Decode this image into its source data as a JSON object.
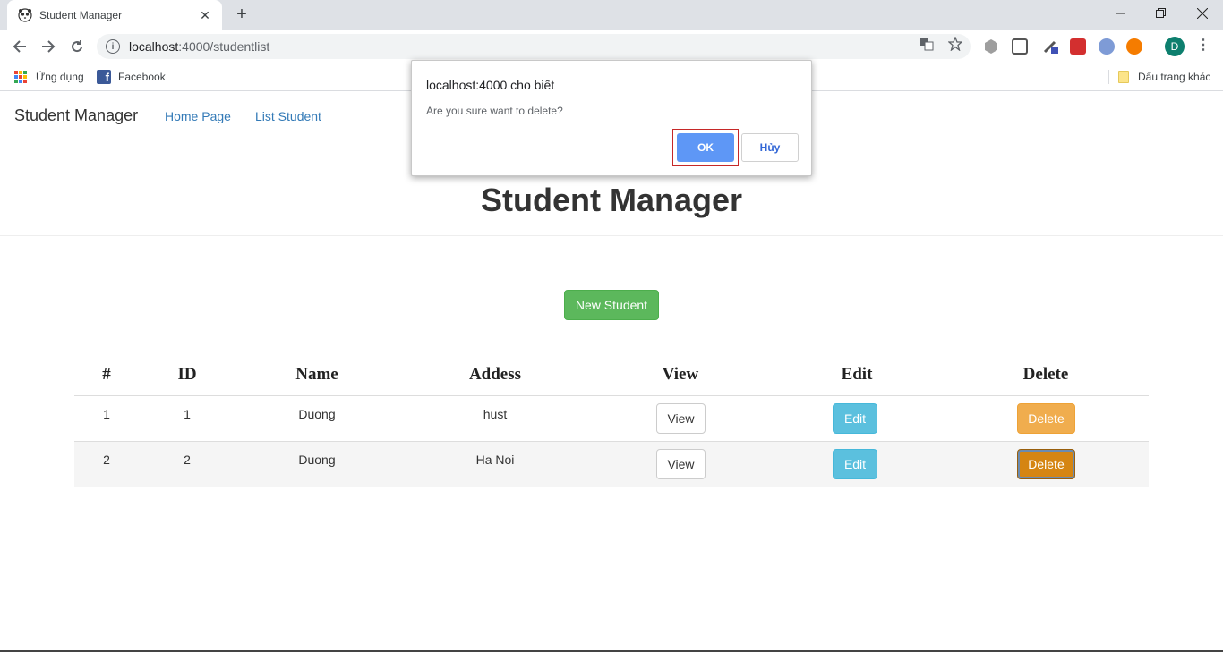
{
  "browser": {
    "tab_title": "Student Manager",
    "tab_close": "✕",
    "new_tab": "+",
    "url_host": "localhost",
    "url_rest": ":4000/studentlist",
    "profile_initial": "D",
    "bookmarks": {
      "apps_label": "Ứng dụng",
      "facebook_label": "Facebook",
      "other_label": "Dấu trang khác"
    }
  },
  "page": {
    "brand": "Student Manager",
    "nav": [
      "Home Page",
      "List Student"
    ],
    "title": "Student Manager",
    "new_button": "New Student",
    "table": {
      "headers": [
        "#",
        "ID",
        "Name",
        "Addess",
        "View",
        "Edit",
        "Delete"
      ],
      "rows": [
        {
          "num": "1",
          "id": "1",
          "name": "Duong",
          "address": "hust",
          "view": "View",
          "edit": "Edit",
          "delete": "Delete"
        },
        {
          "num": "2",
          "id": "2",
          "name": "Duong",
          "address": "Ha Noi",
          "view": "View",
          "edit": "Edit",
          "delete": "Delete"
        }
      ]
    }
  },
  "dialog": {
    "title": "localhost:4000 cho biết",
    "message": "Are you sure want to delete?",
    "ok_label": "OK",
    "cancel_label": "Hủy"
  },
  "colors": {
    "success": "#5cb85c",
    "info": "#5bc0de",
    "warning": "#f0ad4e",
    "link": "#337ab7",
    "dialog_ok": "#5e97f6"
  }
}
